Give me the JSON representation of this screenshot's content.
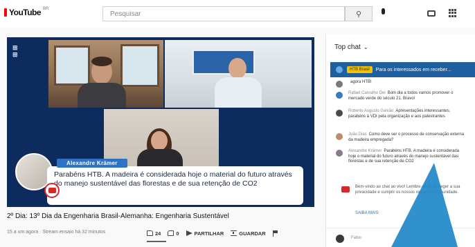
{
  "app": {
    "logo_text": "YouTube",
    "logo_superscript": "BR"
  },
  "search": {
    "placeholder": "Pesquisar"
  },
  "video": {
    "caption": {
      "speaker_name": "Alexandre Krämer",
      "text": "Parabéns HTB. A madeira é considerada hoje o material do futuro através do manejo sustentável das florestas e de sua retenção de CO2"
    },
    "title": "2º Dia: 13º Dia da Engenharia Brasil-Alemanha: Engenharia Sustentável",
    "meta": "15 a um agora · Stream ensaio há 32 minutos",
    "actions": {
      "like_count": "24",
      "dislike_count": "0",
      "share_label": "PARTILHAR",
      "save_label": "GUARDAR"
    }
  },
  "chat": {
    "header": "Top chat",
    "pinned": {
      "badge": "HTB Brasil",
      "text": "Para os interessados em receber..."
    },
    "messages": [
      {
        "author": "",
        "text": "agora HTB!",
        "color": "#7a7a7a"
      },
      {
        "author": "Rafael Carvalho Del",
        "text": "Bom dia a todos vamos promover o mercado verde do século 21. Bravo!",
        "color": "#3a78c8"
      },
      {
        "author": "Roberto Augusto Galvão",
        "text": "Apresentações interessantes, parabéns à VDI pela organização e aos palestrantes",
        "color": "#4a4a4a"
      },
      {
        "author": "João Dias",
        "text": "Como deve ser o processo de conservação externa da madeira empregada?",
        "color": "#c08a6a"
      },
      {
        "author": "Alexandre Krämer",
        "text": "Parabéns HTB. A madeira é considerada hoje o material do futuro através do manejo sustentável das florestas e de sua retenção de CO2",
        "color": "#8a7a8a"
      }
    ],
    "notice": "Bem-vindo ao chat ao vivo! Lembre-se de proteger a sua privacidade e cumprir os nossos regras da comunidade.",
    "notice_link": "SAIBA MAIS",
    "footer_name": "Fabio"
  },
  "colors": {
    "accent_red": "#ff0000",
    "video_bg": "#0d2b5c",
    "pinned_bg": "#1f5fa0",
    "name_tag": "#2f72c4"
  }
}
